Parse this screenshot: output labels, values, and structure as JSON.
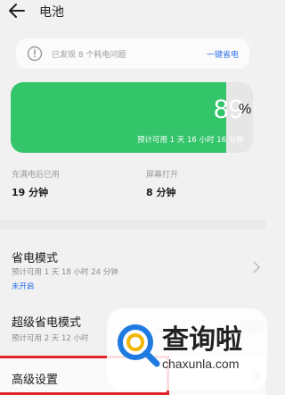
{
  "header": {
    "title": "电池"
  },
  "notice": {
    "text": "已发现 8 个耗电问题",
    "action": "一键省电"
  },
  "battery": {
    "level_fraction": 0.89,
    "percent_text": "89",
    "percent_sign": "%",
    "estimate": "预计可用 1 天 16 小时 16 分钟",
    "colors": {
      "fill": "#34c46a",
      "track": "#e6e6e6"
    }
  },
  "stats": [
    {
      "label": "充满电后已用",
      "value": "19 分钟"
    },
    {
      "label": "屏幕打开",
      "value": "8 分钟"
    }
  ],
  "power_saving": {
    "title": "省电模式",
    "subtitle": "预计可用 1 天 18 小时 24 分钟",
    "status": "未开启"
  },
  "super_power_saving": {
    "title": "超级省电模式",
    "subtitle": "预计可用 2 天 12 小时"
  },
  "advanced": {
    "title": "高级设置"
  },
  "watermark": {
    "title": "查询啦",
    "domain": "chaxunla.com"
  },
  "colors": {
    "accent": "#2b6fe8",
    "highlight": "#e0242a",
    "background": "#f1f1f1"
  }
}
